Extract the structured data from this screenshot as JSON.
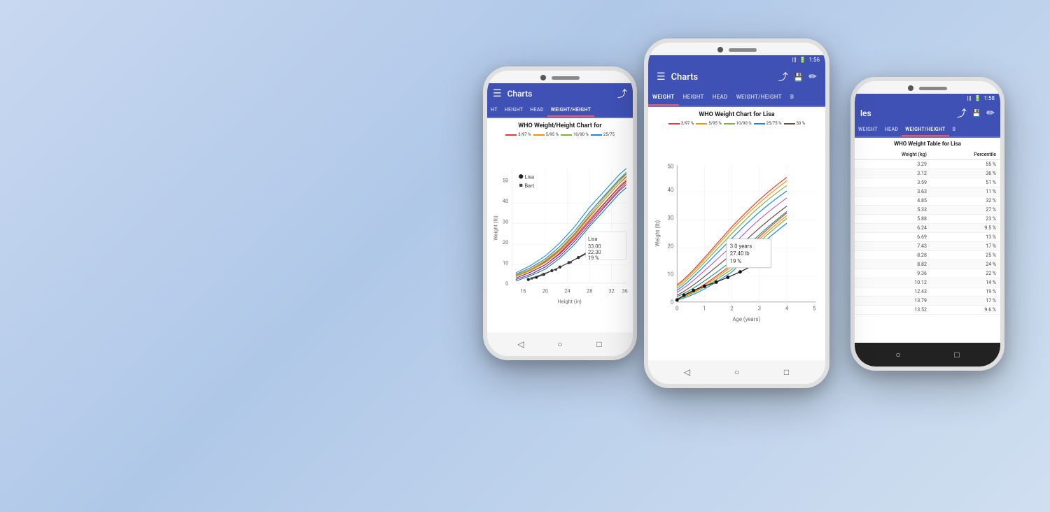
{
  "background": "#c8d8f0",
  "phones": [
    {
      "id": "phone-1",
      "type": "chart-weight-height",
      "statusBar": null,
      "appBar": {
        "title": "Charts",
        "hasHamburger": true,
        "hasShare": true
      },
      "tabs": [
        {
          "label": "HT",
          "active": false
        },
        {
          "label": "HEIGHT",
          "active": false
        },
        {
          "label": "HEAD",
          "active": false
        },
        {
          "label": "WEIGHT/HEIGHT",
          "active": true
        }
      ],
      "chart": {
        "title": "WHO Weight/Height Chart for",
        "legend": [
          {
            "label": "3/97 %",
            "color": "#e53935"
          },
          {
            "label": "5/95 %",
            "color": "#ff8f00"
          },
          {
            "label": "10/90 %",
            "color": "#7cb342"
          },
          {
            "label": "25/75",
            "color": "#1e88e5"
          }
        ],
        "legendItems": [
          "Lisa",
          "Bart"
        ],
        "xLabel": "Height (in)",
        "yLabel": "Weight (lb)",
        "xRange": [
          16,
          36
        ],
        "yRange": [
          0,
          50
        ],
        "tooltip": {
          "name": "Lisa",
          "val1": "33.00",
          "val2": "22.30",
          "val3": "19 %"
        }
      }
    },
    {
      "id": "phone-2",
      "type": "chart-weight-age",
      "statusBar": {
        "time": "1:56"
      },
      "appBar": {
        "title": "Charts",
        "hasHamburger": true,
        "hasShare": true,
        "hasSave": true,
        "hasEdit": true
      },
      "tabs": [
        {
          "label": "WEIGHT",
          "active": true
        },
        {
          "label": "HEIGHT",
          "active": false
        },
        {
          "label": "HEAD",
          "active": false
        },
        {
          "label": "WEIGHT/HEIGHT",
          "active": false
        },
        {
          "label": "B",
          "active": false
        }
      ],
      "chart": {
        "title": "WHO Weight Chart for Lisa",
        "legend": [
          {
            "label": "3/97 %",
            "color": "#e53935"
          },
          {
            "label": "5/95 %",
            "color": "#ff8f00"
          },
          {
            "label": "10/90 %",
            "color": "#7cb342"
          },
          {
            "label": "25/75 %",
            "color": "#1e88e5"
          },
          {
            "label": "50 %",
            "color": "#6d4c41"
          }
        ],
        "xLabel": "Age (years)",
        "yLabel": "Weight (lb)",
        "xRange": [
          0,
          5
        ],
        "yRange": [
          0,
          50
        ],
        "tooltip": {
          "line1": "3.0 years",
          "line2": "27.40 lb",
          "line3": "19 %"
        }
      }
    },
    {
      "id": "phone-3",
      "type": "table",
      "statusBar": {
        "time": "1:58"
      },
      "appBar": {
        "title": "les",
        "hasShare": true,
        "hasSave": true,
        "hasEdit": true
      },
      "tabs": [
        {
          "label": "WEIGHT",
          "active": false
        },
        {
          "label": "HEAD",
          "active": false
        },
        {
          "label": "WEIGHT/HEIGHT",
          "active": false
        },
        {
          "label": "B",
          "active": false
        }
      ],
      "table": {
        "title": "WHO Weight Table for Lisa",
        "headers": [
          "Weight (kg)",
          "Percentile"
        ],
        "rows": [
          [
            "3.29",
            "55 %"
          ],
          [
            "3.12",
            "36 %"
          ],
          [
            "3.59",
            "51 %"
          ],
          [
            "3.63",
            "11 %"
          ],
          [
            "4.85",
            "32 %"
          ],
          [
            "5.33",
            "27 %"
          ],
          [
            "5.88",
            "23 %"
          ],
          [
            "6.24",
            "9.5 %"
          ],
          [
            "6.69",
            "13 %"
          ],
          [
            "7.43",
            "17 %"
          ],
          [
            "8.28",
            "25 %"
          ],
          [
            "8.82",
            "24 %"
          ],
          [
            "9.36",
            "22 %"
          ],
          [
            "10.12",
            "14 %"
          ],
          [
            "12.43",
            "19 %"
          ],
          [
            "13.79",
            "17 %"
          ],
          [
            "13.52",
            "9.6 %"
          ]
        ]
      }
    }
  ]
}
